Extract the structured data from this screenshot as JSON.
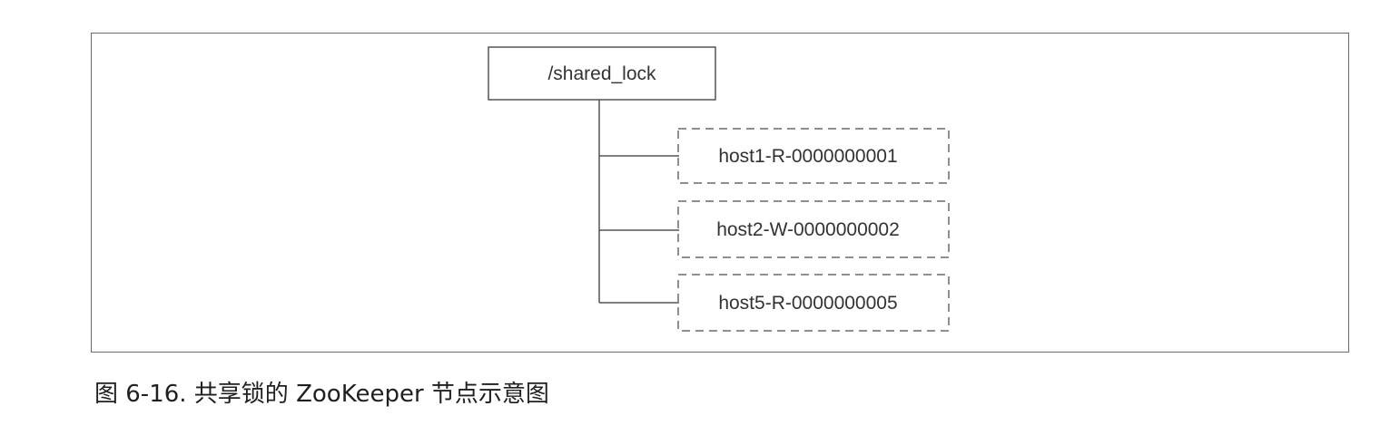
{
  "diagram": {
    "root": {
      "label": "/shared_lock"
    },
    "children": [
      {
        "label": "host1-R-0000000001"
      },
      {
        "label": "host2-W-0000000002"
      },
      {
        "label": "host5-R-0000000005"
      }
    ]
  },
  "caption": "图 6-16.  共享锁的 ZooKeeper 节点示意图",
  "colors": {
    "line": "#555555",
    "dashed_border": "#6a6a6a",
    "frame_border": "#6a6a6a"
  }
}
